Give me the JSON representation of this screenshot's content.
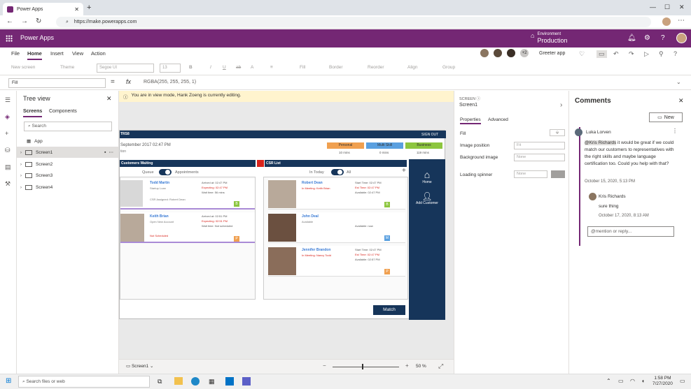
{
  "browser": {
    "tab_title": "Power Apps",
    "url": "https://make.powerapps.com"
  },
  "appbar": {
    "app_name": "Power Apps",
    "env_label": "Environment",
    "env_name": "Production"
  },
  "menubar": {
    "items": [
      "File",
      "Home",
      "Insert",
      "View",
      "Action"
    ],
    "collab_more": "+2",
    "greeter": "Greeter app"
  },
  "ribbon": {
    "new_screen": "New screen",
    "theme": "Theme",
    "font": "Segoe UI",
    "size": "13",
    "fill": "Fill",
    "border": "Border",
    "reorder": "Reorder",
    "align": "Align",
    "group": "Group"
  },
  "formula": {
    "property": "Fill",
    "value": "RGBA(255, 255, 255, 1)"
  },
  "tree": {
    "title": "Tree view",
    "tab_screens": "Screens",
    "tab_components": "Components",
    "search_placeholder": "Search",
    "items": [
      "App",
      "Screen1",
      "Screen2",
      "Screen3",
      "Screen4"
    ]
  },
  "notice": "You are in view mode, Hank Zoeng is currently editing.",
  "appscreen": {
    "logo": "TRS8",
    "sign_out": "SIGN OUT",
    "date": "September 2017 02:47 PM",
    "subtitle": "tion",
    "tags": [
      {
        "label": "Personal",
        "mins": "10 mins",
        "color": "#f0a050"
      },
      {
        "label": "Multi Skill",
        "mins": "0 mins",
        "color": "#5aa0e0"
      },
      {
        "label": "Business",
        "mins": "119 mins",
        "color": "#8dc63f"
      }
    ],
    "customers_waiting": "Customers Waiting",
    "csr_list": "CSR List",
    "queue": "Queue",
    "appointments": "Appointments",
    "in_today": "In Today",
    "all": "All",
    "customers": [
      {
        "name": "Todd Martin",
        "role": "Startup Loan",
        "note": "CSR Assigned: Robert Dean",
        "arrived": "02:47 PM",
        "expecting": "02:47 PM",
        "wait": "56 mins",
        "badge": "B",
        "badge_color": "#8dc63f"
      },
      {
        "name": "Keith Brian",
        "role": "Open New Account",
        "note": "Not Scheduled",
        "arrived": "02:51 PM",
        "expecting": "02:51 PM",
        "wait": "Not scheduled",
        "badge": "P",
        "badge_color": "#f0a050"
      }
    ],
    "csrs": [
      {
        "name": "Robert Dean",
        "status": "In Meeting: Keith Brian",
        "start": "02:47 PM",
        "est": "02:47 PM",
        "available": "02:47 PM",
        "badge": "B",
        "badge_color": "#8dc63f"
      },
      {
        "name": "John Deal",
        "status": "Available",
        "start": "",
        "est": "",
        "available": "now",
        "badge": "M",
        "badge_color": "#5aa0e0"
      },
      {
        "name": "Jennifer Brandon",
        "status": "In Meeting: Nancy Todd",
        "start": "02:47 PM",
        "est": "02:47 PM",
        "available": "02:57 PM",
        "badge": "P",
        "badge_color": "#f0a050"
      }
    ],
    "labels": {
      "arrived": "Arrived at:",
      "expecting": "Expecting:",
      "wait": "Wait time:",
      "start": "Start Time:",
      "est": "Est Time:",
      "available": "Available:"
    },
    "home": "Home",
    "add_customer": "Add Customer",
    "match": "Match"
  },
  "canvas_footer": {
    "screen": "Screen1",
    "zoom": "50",
    "zoom_unit": "%"
  },
  "props": {
    "section": "SCREEN",
    "name": "Screen1",
    "tab_properties": "Properties",
    "tab_advanced": "Advanced",
    "fill": "Fill",
    "image_position": "Image position",
    "image_position_val": "Fit",
    "background_image": "Background image",
    "background_image_val": "None",
    "loading_spinner": "Loading spinner",
    "loading_spinner_val": "None"
  },
  "comments": {
    "title": "Comments",
    "new": "New",
    "author1": "Luka Lorven",
    "mention": "@Kris Richards",
    "body1": " it would be great if we could match our customers to representatives with the right skills and maybe language certification too. Could you help with that?",
    "date1": "October 15, 2020, 5:13 PM",
    "author2": "Kris Richards",
    "body2": "sure thing",
    "date2": "October 17, 2020, 8:13 AM",
    "reply_placeholder": "@mention or reply..."
  },
  "taskbar": {
    "search_placeholder": "Search files or web",
    "time": "1:58 PM",
    "date": "7/27/2020"
  }
}
